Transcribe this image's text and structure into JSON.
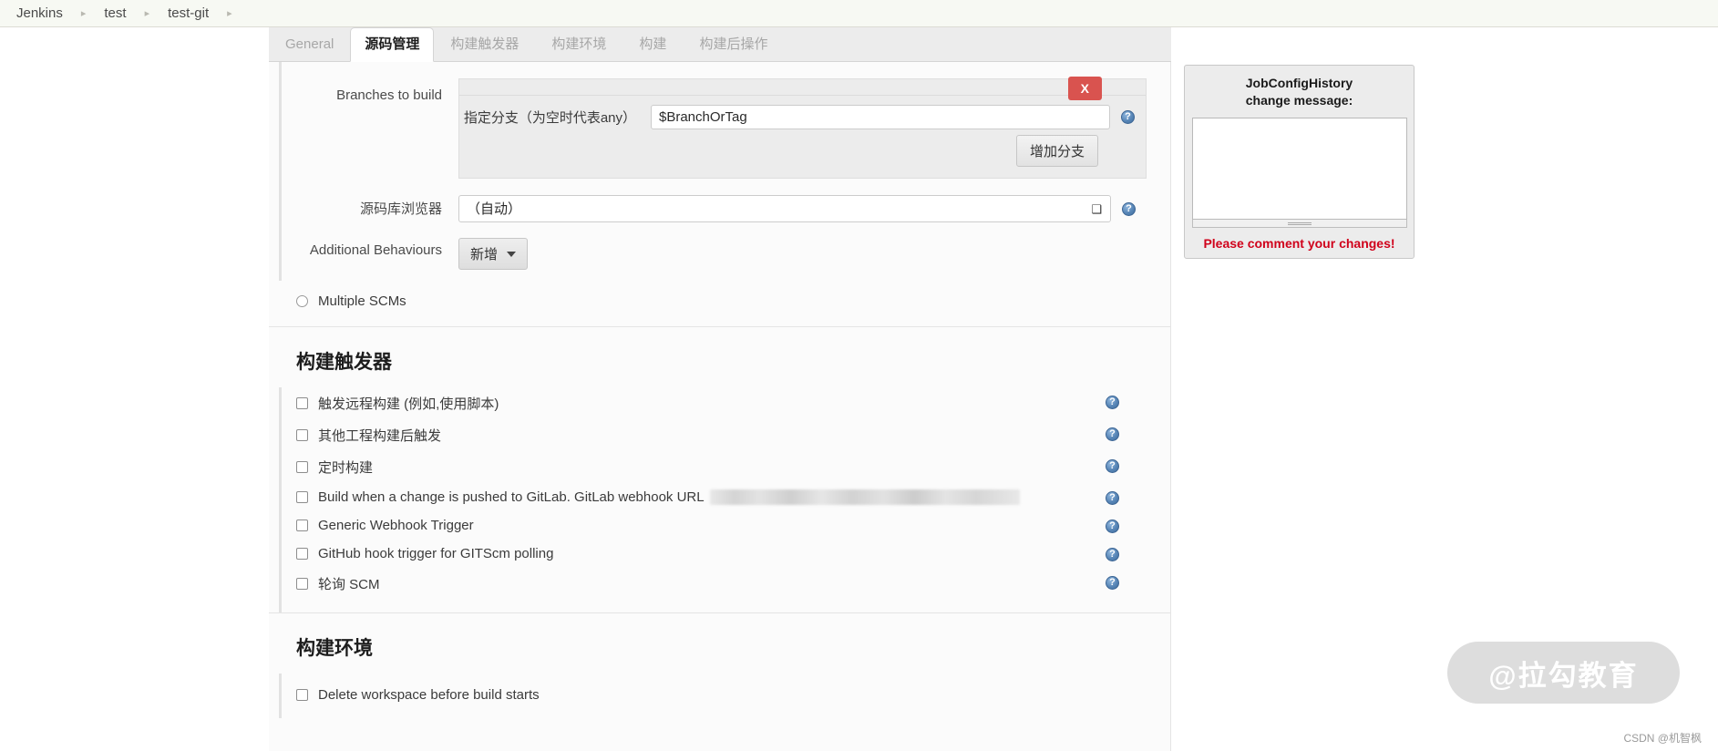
{
  "breadcrumb": {
    "items": [
      "Jenkins",
      "test",
      "test-git"
    ],
    "separator": "▸"
  },
  "tabs": [
    {
      "label": "General",
      "active": false
    },
    {
      "label": "源码管理",
      "active": true
    },
    {
      "label": "构建触发器",
      "active": false
    },
    {
      "label": "构建环境",
      "active": false
    },
    {
      "label": "构建",
      "active": false
    },
    {
      "label": "构建后操作",
      "active": false
    }
  ],
  "scm": {
    "branches_label": "Branches to build",
    "branch_spec_label": "指定分支（为空时代表any）",
    "branch_spec_value": "$BranchOrTag",
    "branch_spec_placeholder": "",
    "delete_label": "X",
    "add_branch_label": "增加分支",
    "repo_browser_label": "源码库浏览器",
    "repo_browser_value": "（自动）",
    "repo_browser_options": [
      "（自动）"
    ],
    "additional_behaviours_label": "Additional Behaviours",
    "add_button_label": "新增",
    "multiple_scms_label": "Multiple SCMs",
    "multiple_scms_checked": false,
    "help_icon": "help-icon"
  },
  "build_triggers": {
    "heading": "构建触发器",
    "options": [
      {
        "label": "触发远程构建 (例如,使用脚本)",
        "checked": false,
        "help": true,
        "redacted": false
      },
      {
        "label": "其他工程构建后触发",
        "checked": false,
        "help": true,
        "redacted": false
      },
      {
        "label": "定时构建",
        "checked": false,
        "help": true,
        "redacted": false
      },
      {
        "label": "Build when a change is pushed to GitLab. GitLab webhook URL",
        "checked": false,
        "help": true,
        "redacted": true
      },
      {
        "label": "Generic Webhook Trigger",
        "checked": false,
        "help": true,
        "redacted": false
      },
      {
        "label": "GitHub hook trigger for GITScm polling",
        "checked": false,
        "help": true,
        "redacted": false
      },
      {
        "label": "轮询 SCM",
        "checked": false,
        "help": true,
        "redacted": false
      }
    ]
  },
  "build_environment": {
    "heading": "构建环境",
    "options": [
      {
        "label": "Delete workspace before build starts",
        "checked": false,
        "help": false,
        "redacted": false
      }
    ]
  },
  "job_config_history": {
    "title_line1": "JobConfigHistory",
    "title_line2": "change message:",
    "textarea_value": "",
    "textarea_placeholder": "",
    "warning": "Please comment your changes!"
  },
  "watermarks": {
    "badge": "@拉勾教育",
    "corner": "CSDN @机智枫"
  },
  "colors": {
    "danger": "#d9534f",
    "warning_text": "#d0021b",
    "accent_help": "#4d7dab",
    "breadcrumb_bg": "#f7f9f3"
  }
}
